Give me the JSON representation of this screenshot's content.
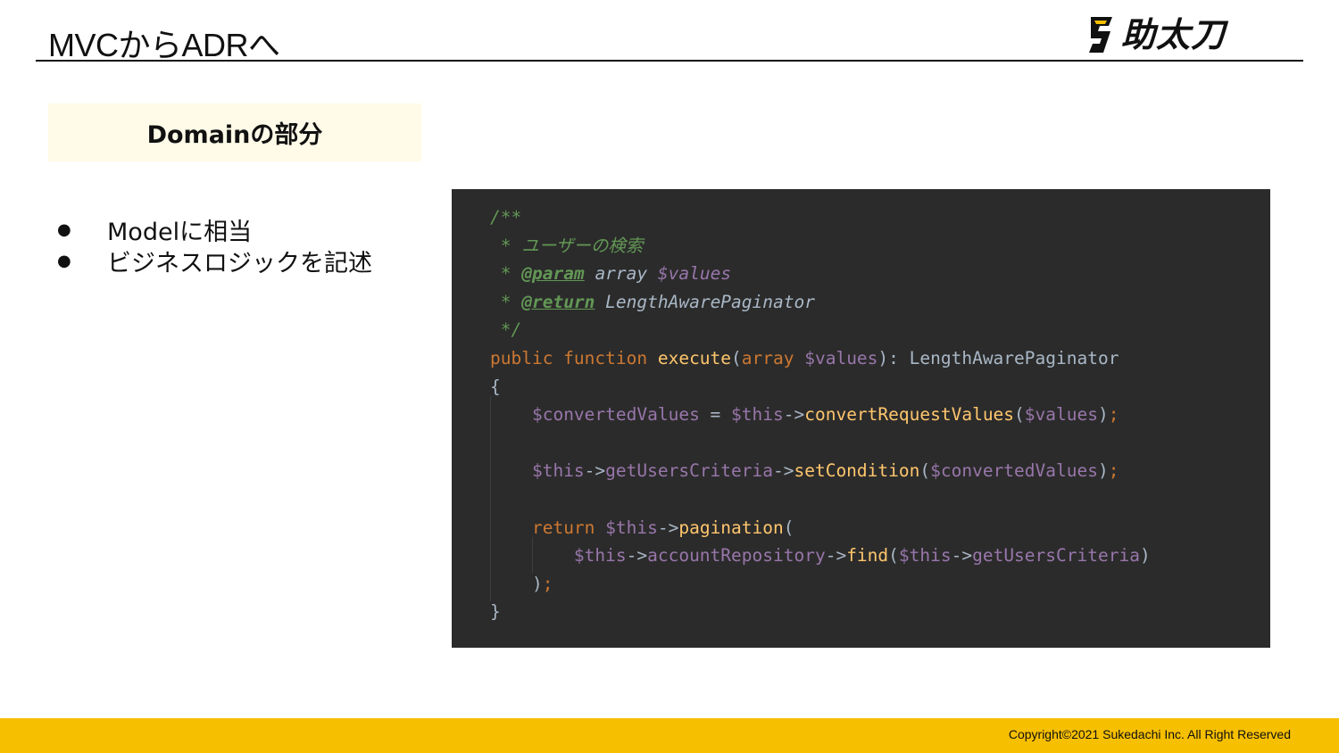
{
  "slide": {
    "title": "MVCからADRへ",
    "logo_text": "助太刀",
    "section_heading": "Domainの部分",
    "bullets": [
      "Modelに相当",
      "ビジネスロジックを記述"
    ],
    "bullet_glyph": "●",
    "copyright": "Copyright©2021 Sukedachi Inc. All Right Reserved"
  },
  "code": {
    "lines": [
      [
        {
          "t": "/**",
          "c": "cm"
        }
      ],
      [
        {
          "t": " * ユーザーの検索",
          "c": "cm"
        }
      ],
      [
        {
          "t": " * ",
          "c": "cm"
        },
        {
          "t": "@param",
          "c": "tag"
        },
        {
          "t": " ",
          "c": "cm"
        },
        {
          "t": "array",
          "c": "type"
        },
        {
          "t": " ",
          "c": "cm"
        },
        {
          "t": "$values",
          "c": "docvar"
        }
      ],
      [
        {
          "t": " * ",
          "c": "cm"
        },
        {
          "t": "@return",
          "c": "tag"
        },
        {
          "t": " ",
          "c": "cm"
        },
        {
          "t": "LengthAwarePaginator",
          "c": "type"
        }
      ],
      [
        {
          "t": " */",
          "c": "cm"
        }
      ],
      [
        {
          "t": "public function ",
          "c": "kw"
        },
        {
          "t": "execute",
          "c": "fn"
        },
        {
          "t": "(",
          "c": "def"
        },
        {
          "t": "array ",
          "c": "kw"
        },
        {
          "t": "$values",
          "c": "var"
        },
        {
          "t": "): LengthAwarePaginator",
          "c": "def"
        }
      ],
      [
        {
          "t": "{",
          "c": "def"
        }
      ],
      [
        {
          "t": "    ",
          "c": "def"
        },
        {
          "t": "$convertedValues",
          "c": "var"
        },
        {
          "t": " = ",
          "c": "def"
        },
        {
          "t": "$this",
          "c": "var"
        },
        {
          "t": "->",
          "c": "def"
        },
        {
          "t": "convertRequestValues",
          "c": "fn"
        },
        {
          "t": "(",
          "c": "def"
        },
        {
          "t": "$values",
          "c": "var"
        },
        {
          "t": ")",
          "c": "def"
        },
        {
          "t": ";",
          "c": "kw"
        }
      ],
      [
        {
          "t": "",
          "c": "def"
        }
      ],
      [
        {
          "t": "    ",
          "c": "def"
        },
        {
          "t": "$this",
          "c": "var"
        },
        {
          "t": "->",
          "c": "def"
        },
        {
          "t": "getUsersCriteria",
          "c": "var"
        },
        {
          "t": "->",
          "c": "def"
        },
        {
          "t": "setCondition",
          "c": "fn"
        },
        {
          "t": "(",
          "c": "def"
        },
        {
          "t": "$convertedValues",
          "c": "var"
        },
        {
          "t": ")",
          "c": "def"
        },
        {
          "t": ";",
          "c": "kw"
        }
      ],
      [
        {
          "t": "",
          "c": "def"
        }
      ],
      [
        {
          "t": "    ",
          "c": "def"
        },
        {
          "t": "return ",
          "c": "kw"
        },
        {
          "t": "$this",
          "c": "var"
        },
        {
          "t": "->",
          "c": "def"
        },
        {
          "t": "pagination",
          "c": "fn"
        },
        {
          "t": "(",
          "c": "def"
        }
      ],
      [
        {
          "t": "        ",
          "c": "def"
        },
        {
          "t": "$this",
          "c": "var"
        },
        {
          "t": "->",
          "c": "def"
        },
        {
          "t": "accountRepository",
          "c": "var"
        },
        {
          "t": "->",
          "c": "def"
        },
        {
          "t": "find",
          "c": "fn"
        },
        {
          "t": "(",
          "c": "def"
        },
        {
          "t": "$this",
          "c": "var"
        },
        {
          "t": "->",
          "c": "def"
        },
        {
          "t": "getUsersCriteria",
          "c": "var"
        },
        {
          "t": ")",
          "c": "def"
        }
      ],
      [
        {
          "t": "    ",
          "c": "def"
        },
        {
          "t": ")",
          "c": "def"
        },
        {
          "t": ";",
          "c": "kw"
        }
      ],
      [
        {
          "t": "}",
          "c": "def"
        }
      ]
    ]
  },
  "colors": {
    "footer_bar": "#f6bf00",
    "section_background": "#fffbe8",
    "code_background": "#2b2b2b",
    "logo_accent": "#f6bf00"
  }
}
